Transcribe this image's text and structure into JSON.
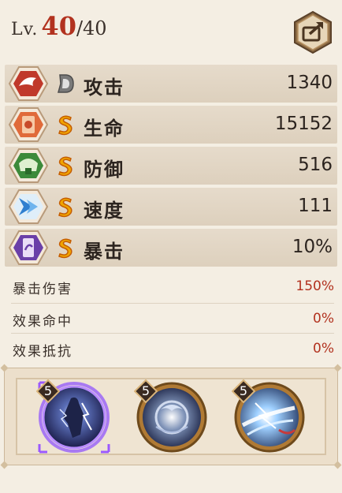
{
  "level": {
    "prefix": "Lv.",
    "current": "40",
    "max": "/40"
  },
  "stats": [
    {
      "key": "attack",
      "label": "攻击",
      "value": "1340",
      "grade": "D",
      "icon": "attack-icon",
      "iconColor": "#c0392b"
    },
    {
      "key": "hp",
      "label": "生命",
      "value": "15152",
      "grade": "S",
      "icon": "hp-icon",
      "iconColor": "#d9562c"
    },
    {
      "key": "defense",
      "label": "防御",
      "value": "516",
      "grade": "S",
      "icon": "defense-icon",
      "iconColor": "#3c8a3a"
    },
    {
      "key": "speed",
      "label": "速度",
      "value": "111",
      "grade": "S",
      "icon": "speed-icon",
      "iconColor": "#2f7fd0"
    },
    {
      "key": "crit",
      "label": "暴击",
      "value": "10%",
      "grade": "S",
      "icon": "crit-icon",
      "iconColor": "#6a3fa8"
    }
  ],
  "extra_stats": [
    {
      "label": "暴击伤害",
      "value": "150%"
    },
    {
      "label": "效果命中",
      "value": "0%"
    },
    {
      "label": "效果抵抗",
      "value": "0%"
    }
  ],
  "skills": [
    {
      "level": "5",
      "selected": true,
      "name": "skill-1-icon"
    },
    {
      "level": "5",
      "selected": false,
      "name": "skill-2-icon"
    },
    {
      "level": "5",
      "selected": false,
      "name": "skill-3-icon"
    }
  ],
  "colors": {
    "accent_red": "#b2321f",
    "grade_s": "#f0a500",
    "grade_d": "#6b6b6b",
    "selected_glow": "#8a4cff",
    "skill_ring": "#c48a3a"
  }
}
